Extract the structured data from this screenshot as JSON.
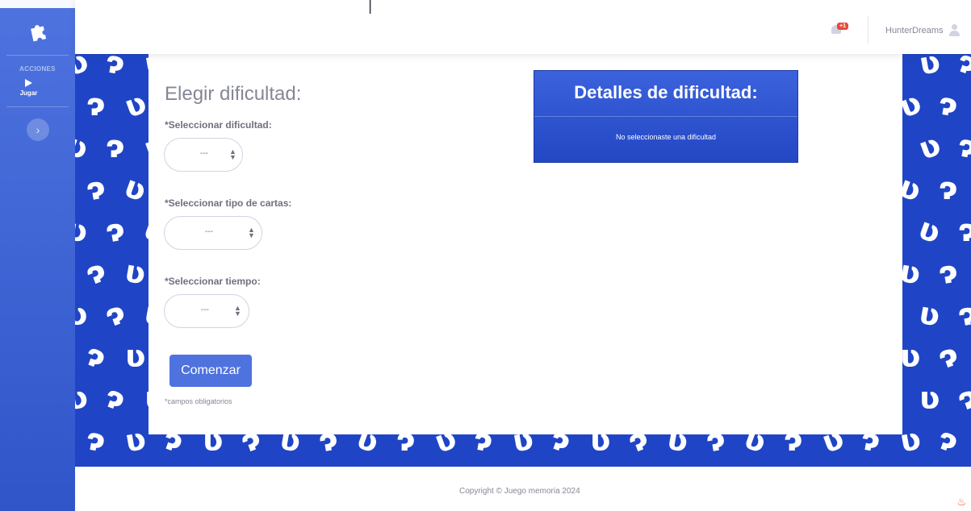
{
  "topbar": {
    "fragment": "|",
    "notification_badge": "+1",
    "username": "HunterDreams"
  },
  "sidebar": {
    "heading": "ACCIONES",
    "items": [
      {
        "label": "Jugar",
        "icon": "play-icon"
      }
    ],
    "toggle_icon": "chevron-right-icon"
  },
  "form": {
    "title": "Elegir dificultad:",
    "fields": [
      {
        "label": "*Seleccionar dificultad:",
        "value": "---"
      },
      {
        "label": "*Seleccionar tipo de cartas:",
        "value": "---"
      },
      {
        "label": "*Seleccionar tiempo:",
        "value": "---"
      }
    ],
    "submit_label": "Comenzar",
    "required_note": "*campos obligatorios"
  },
  "details": {
    "title": "Detalles de dificultad:",
    "message": "No seleccionaste una dificultad"
  },
  "footer": {
    "copyright": "Copyright © Juego memoria 2024",
    "scroll_icon": "flame-icon"
  },
  "colors": {
    "primary": "#4e73df",
    "pattern_bg": "#1f45c6",
    "badge": "#e74a3b"
  }
}
